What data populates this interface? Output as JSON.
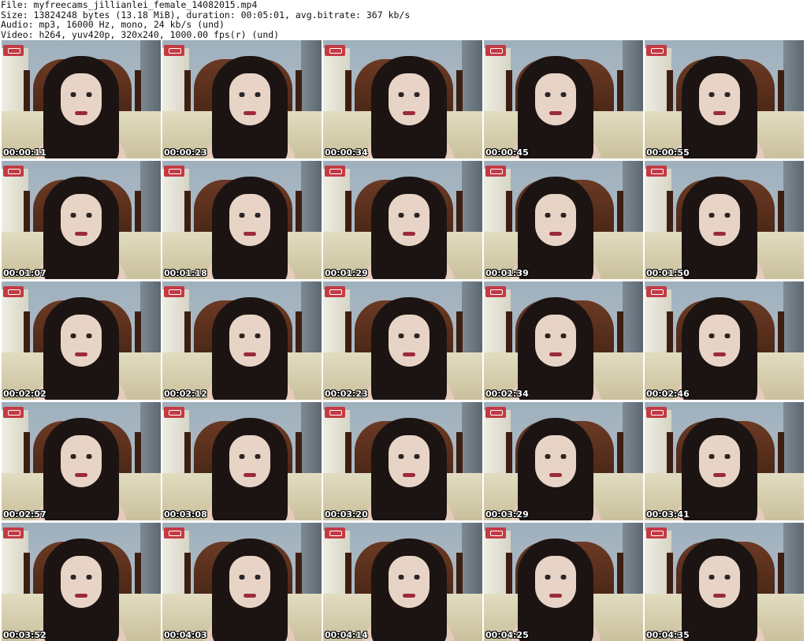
{
  "header": {
    "file": "File: myfreecams_jillianlei_female_14082015.mp4",
    "size": "Size: 13824248 bytes (13.18 MiB), duration: 00:05:01, avg.bitrate: 367 kb/s",
    "audio": "Audio: mp3, 16000 Hz, mono, 24 kb/s (und)",
    "video": "Video: h264, yuv420p, 320x240, 1000.00 fps(r) (und)"
  },
  "thumbnails": [
    {
      "time": "00:00:11"
    },
    {
      "time": "00:00:23"
    },
    {
      "time": "00:00:34"
    },
    {
      "time": "00:00:45"
    },
    {
      "time": "00:00:55"
    },
    {
      "time": "00:01:07"
    },
    {
      "time": "00:01:18"
    },
    {
      "time": "00:01:29"
    },
    {
      "time": "00:01:39"
    },
    {
      "time": "00:01:50"
    },
    {
      "time": "00:02:02"
    },
    {
      "time": "00:02:12"
    },
    {
      "time": "00:02:23"
    },
    {
      "time": "00:02:34"
    },
    {
      "time": "00:02:46"
    },
    {
      "time": "00:02:57"
    },
    {
      "time": "00:03:08"
    },
    {
      "time": "00:03:20"
    },
    {
      "time": "00:03:29"
    },
    {
      "time": "00:03:41"
    },
    {
      "time": "00:03:52"
    },
    {
      "time": "00:04:03"
    },
    {
      "time": "00:04:14"
    },
    {
      "time": "00:04:25"
    },
    {
      "time": "00:04:35"
    }
  ]
}
